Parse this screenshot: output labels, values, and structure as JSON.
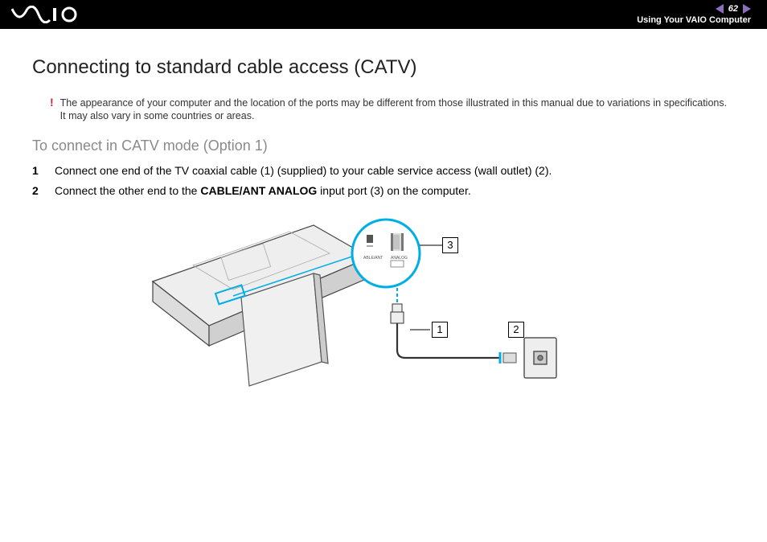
{
  "header": {
    "logo_text": "VAIO",
    "page_number": "62",
    "breadcrumb": "Using Your VAIO Computer"
  },
  "page": {
    "title": "Connecting to standard cable access (CATV)",
    "warning_mark": "!",
    "warning_text": "The appearance of your computer and the location of the ports may be different from those illustrated in this manual due to variations in specifications. It may also vary in some countries or areas.",
    "subtitle": "To connect in CATV mode (Option 1)",
    "steps": [
      {
        "n": "1",
        "text_a": "Connect one end of the TV coaxial cable (1) (supplied) to your cable service access (wall outlet) (2)."
      },
      {
        "n": "2",
        "text_a": "Connect the other end to the ",
        "bold": "CABLE/ANT ANALOG",
        "text_b": " input port (3) on the computer."
      }
    ],
    "diagram": {
      "callout1": "1",
      "callout2": "2",
      "callout3": "3",
      "port_label_left": "ABLE/ANT",
      "port_label_right": "ANALOG"
    }
  }
}
